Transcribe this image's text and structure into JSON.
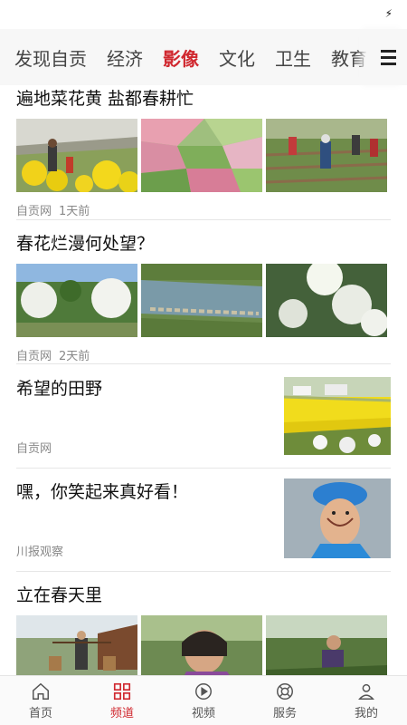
{
  "status": {
    "icon": "charging-bolt-icon"
  },
  "tabs": [
    "发现自贡",
    "经济",
    "影像",
    "文化",
    "卫生",
    "教育"
  ],
  "active_tab": "影像",
  "articles": [
    {
      "title": "遍地菜花黄 盐都春耕忙",
      "source": "自贡网",
      "time": "1天前",
      "images": [
        "farmers-in-rapeseed-field",
        "terraced-fields-aerial",
        "workers-planting-in-field"
      ]
    },
    {
      "title": "春花烂漫何处望？",
      "source": "自贡网",
      "time": "2天前",
      "images": [
        "blossoming-trees-park",
        "river-with-stepping-stones",
        "white-blossom-sunlight"
      ]
    },
    {
      "title": "希望的田野",
      "source": "自贡网",
      "images": [
        "yellow-rapeseed-field-village"
      ]
    },
    {
      "title": "嘿，你笑起来真好看！",
      "source": "川报观察",
      "images": [
        "smiling-nurse-portrait"
      ]
    },
    {
      "title": "立在春天里",
      "images": [
        "farmer-carrying-baskets",
        "woman-working-in-garden",
        "woman-tending-crops"
      ]
    }
  ],
  "nav": [
    {
      "label": "首页",
      "icon": "home-icon"
    },
    {
      "label": "频道",
      "icon": "grid-icon"
    },
    {
      "label": "视频",
      "icon": "play-icon"
    },
    {
      "label": "服务",
      "icon": "lifebuoy-icon"
    },
    {
      "label": "我的",
      "icon": "user-icon"
    }
  ],
  "colors": {
    "accent": "#d0282f"
  }
}
